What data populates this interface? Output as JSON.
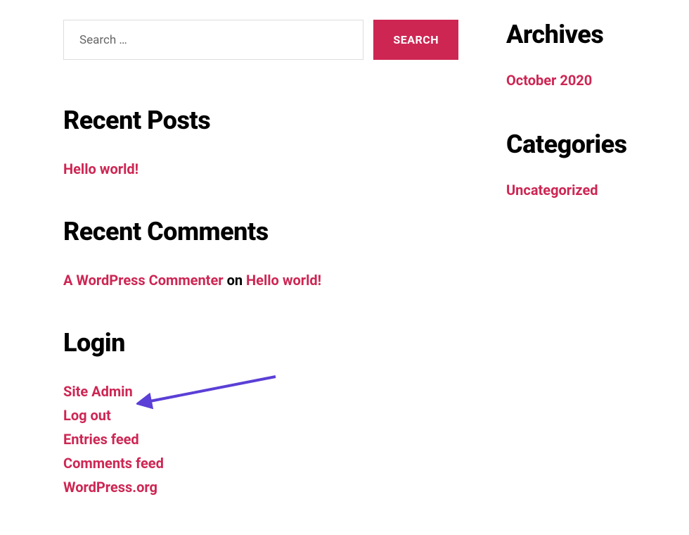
{
  "search": {
    "placeholder": "Search …",
    "button": "SEARCH"
  },
  "widgets": {
    "recentPosts": {
      "title": "Recent Posts",
      "items": [
        {
          "label": "Hello world!"
        }
      ]
    },
    "recentComments": {
      "title": "Recent Comments",
      "items": [
        {
          "author": "A WordPress Commenter",
          "on": "on",
          "post": "Hello world!"
        }
      ]
    },
    "login": {
      "title": "Login",
      "items": [
        {
          "label": "Site Admin"
        },
        {
          "label": "Log out"
        },
        {
          "label": "Entries feed"
        },
        {
          "label": "Comments feed"
        },
        {
          "label": "WordPress.org"
        }
      ]
    },
    "archives": {
      "title": "Archives",
      "items": [
        {
          "label": "October 2020"
        }
      ]
    },
    "categories": {
      "title": "Categories",
      "items": [
        {
          "label": "Uncategorized"
        }
      ]
    }
  }
}
